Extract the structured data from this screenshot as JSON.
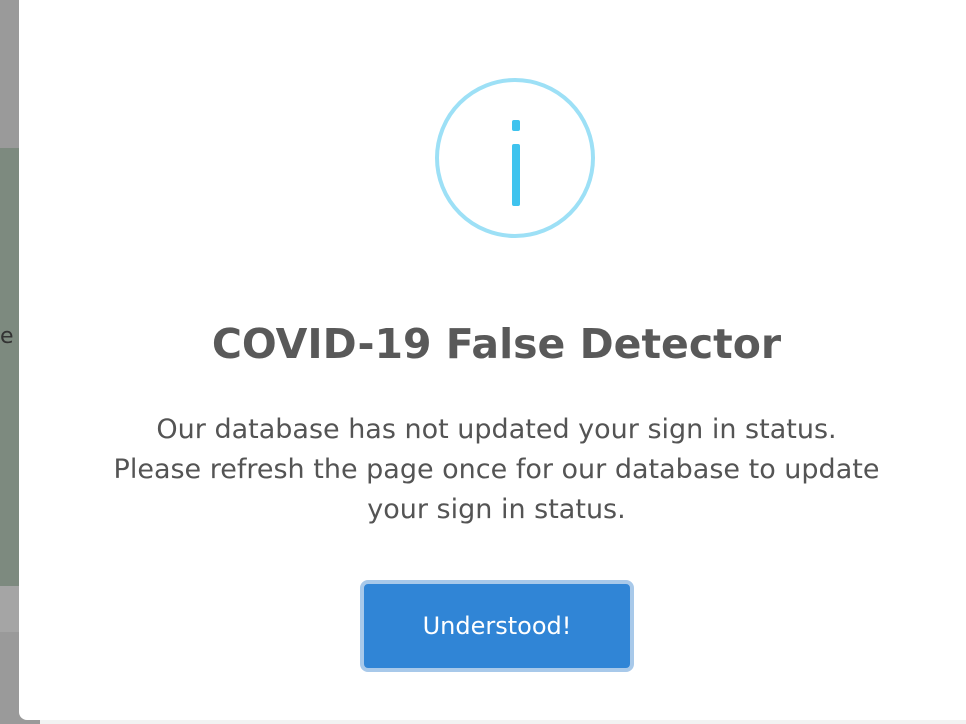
{
  "background": {
    "partial_text": "e"
  },
  "modal": {
    "icon": "info-icon",
    "title": "COVID-19 False Detector",
    "message": "Our database has not updated your sign in status. Please refresh the page once for our database to update your sign in status.",
    "confirm_label": "Understood!"
  },
  "colors": {
    "icon_border": "#9de0f6",
    "icon_fill": "#3fc3ee",
    "title": "#595959",
    "message": "#545454",
    "button_bg": "#3085d6",
    "button_focus_ring": "#a8c9ea"
  }
}
